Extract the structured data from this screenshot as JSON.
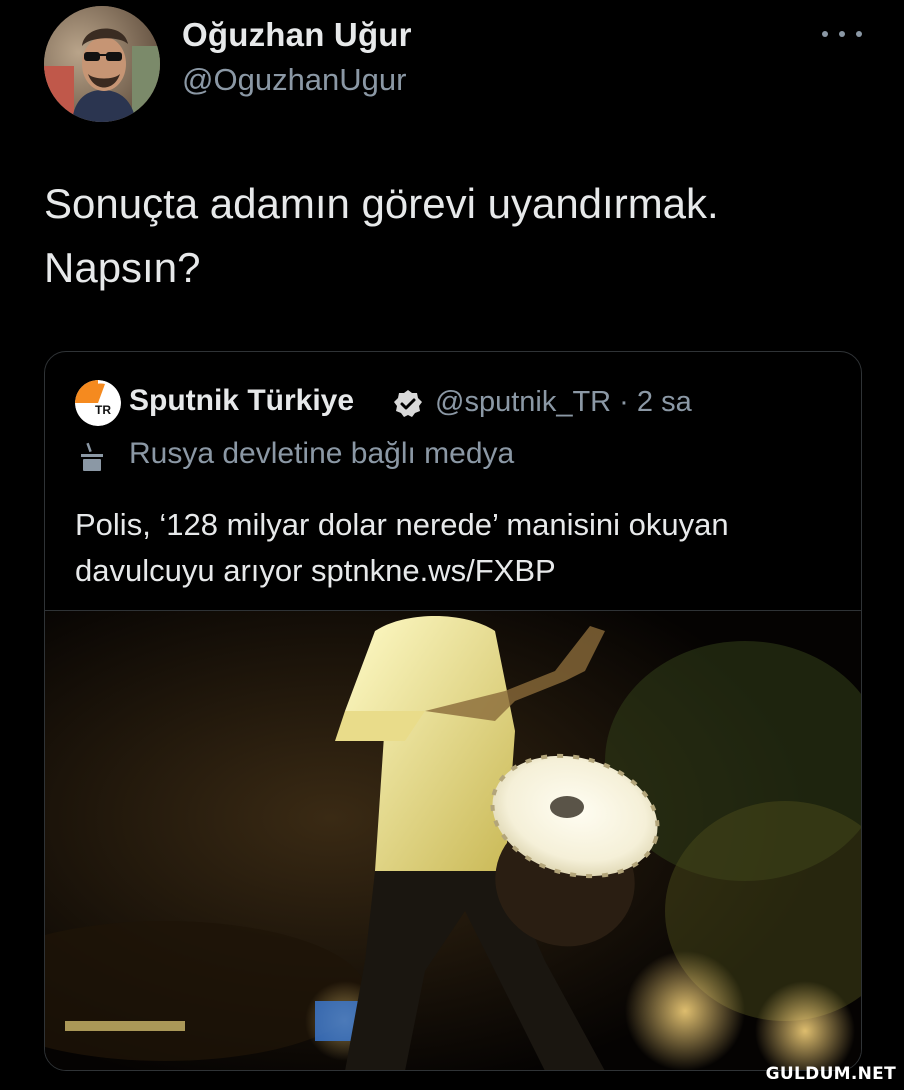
{
  "tweet": {
    "author": {
      "display_name": "Oğuzhan Uğur",
      "handle": "@OguzhanUgur",
      "avatar": "profile-photo"
    },
    "more_icon": "ellipsis-icon",
    "text_line1": "Sonuçta adamın görevi uyandırmak.",
    "text_line2": "Napsın?"
  },
  "quote": {
    "display_name": "Sputnik Türkiye",
    "verified_icon": "verified-badge-icon",
    "handle_time": "@sputnik_TR · 2 sa",
    "label_icon": "state-media-podium-icon",
    "label": "Rusya devletine bağlı medya",
    "text_line1": "Polis, ‘128 milyar dolar nerede’ manisini okuyan",
    "text_line2": "davulcuyu arıyor sptnkne.ws/FXBP",
    "image": "drummer-photo",
    "logo_text": "TR"
  },
  "watermark": "GULDUM.NET",
  "colors": {
    "background": "#000000",
    "text": "#e7e9ea",
    "secondary": "#8b98a5",
    "border": "#2f3336",
    "sputnik_orange": "#f58a1f"
  }
}
